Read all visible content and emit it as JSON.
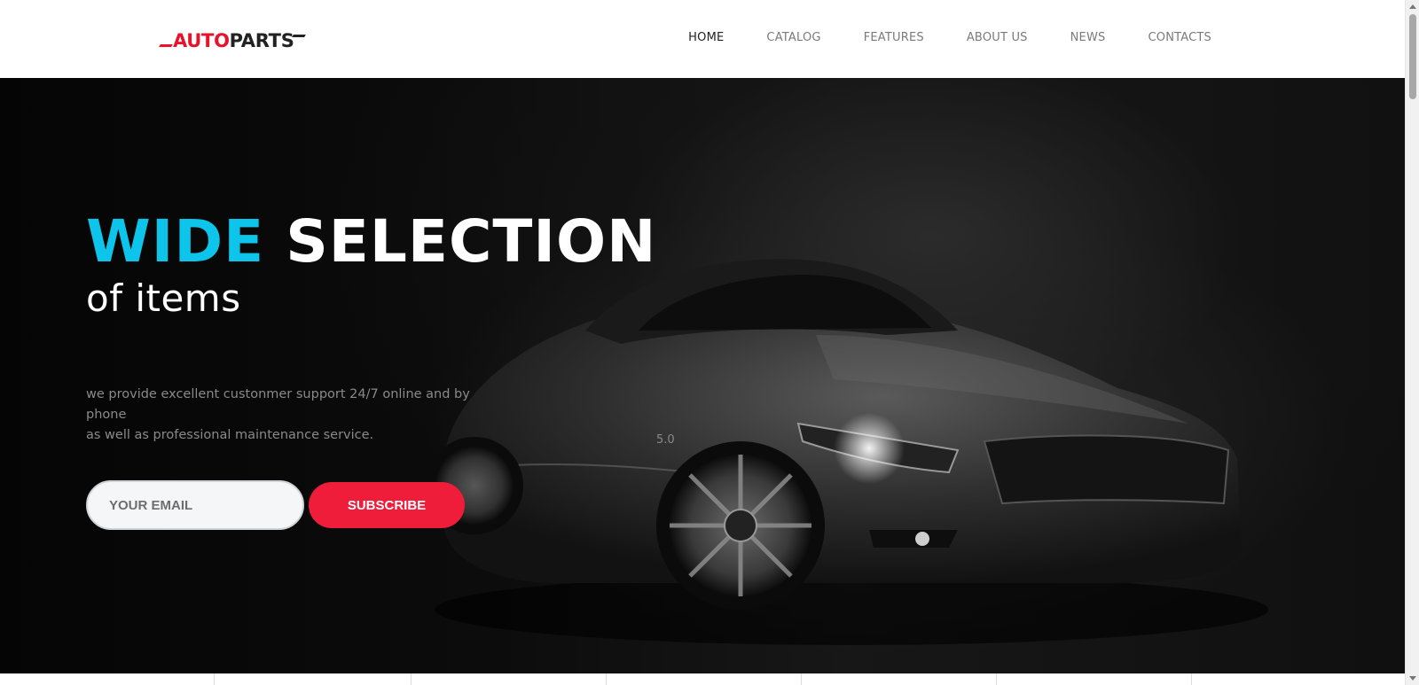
{
  "header": {
    "logo": {
      "auto": "AUTO",
      "parts": "PARTS"
    },
    "nav": [
      {
        "label": "HOME",
        "active": true
      },
      {
        "label": "CATALOG",
        "active": false
      },
      {
        "label": "FEATURES",
        "active": false
      },
      {
        "label": "ABOUT US",
        "active": false
      },
      {
        "label": "NEWS",
        "active": false
      },
      {
        "label": "CONTACTS",
        "active": false
      }
    ]
  },
  "hero": {
    "headline_accent": "WIDE",
    "headline_main": "SELECTION",
    "subheadline": "of items",
    "description_line1": "we provide excellent custonmer support 24/7 online and by phone",
    "description_line2": "as well as professional maintenance service.",
    "email_placeholder": "YOUR EMAIL",
    "subscribe_label": "SUBSCRIBE",
    "car_badge": "5.0"
  },
  "colors": {
    "accent_cyan": "#0dc5ea",
    "brand_red": "#ef1c3a",
    "logo_red": "#e8132b",
    "nav_text": "#7a7a7a",
    "nav_active": "#222222"
  }
}
